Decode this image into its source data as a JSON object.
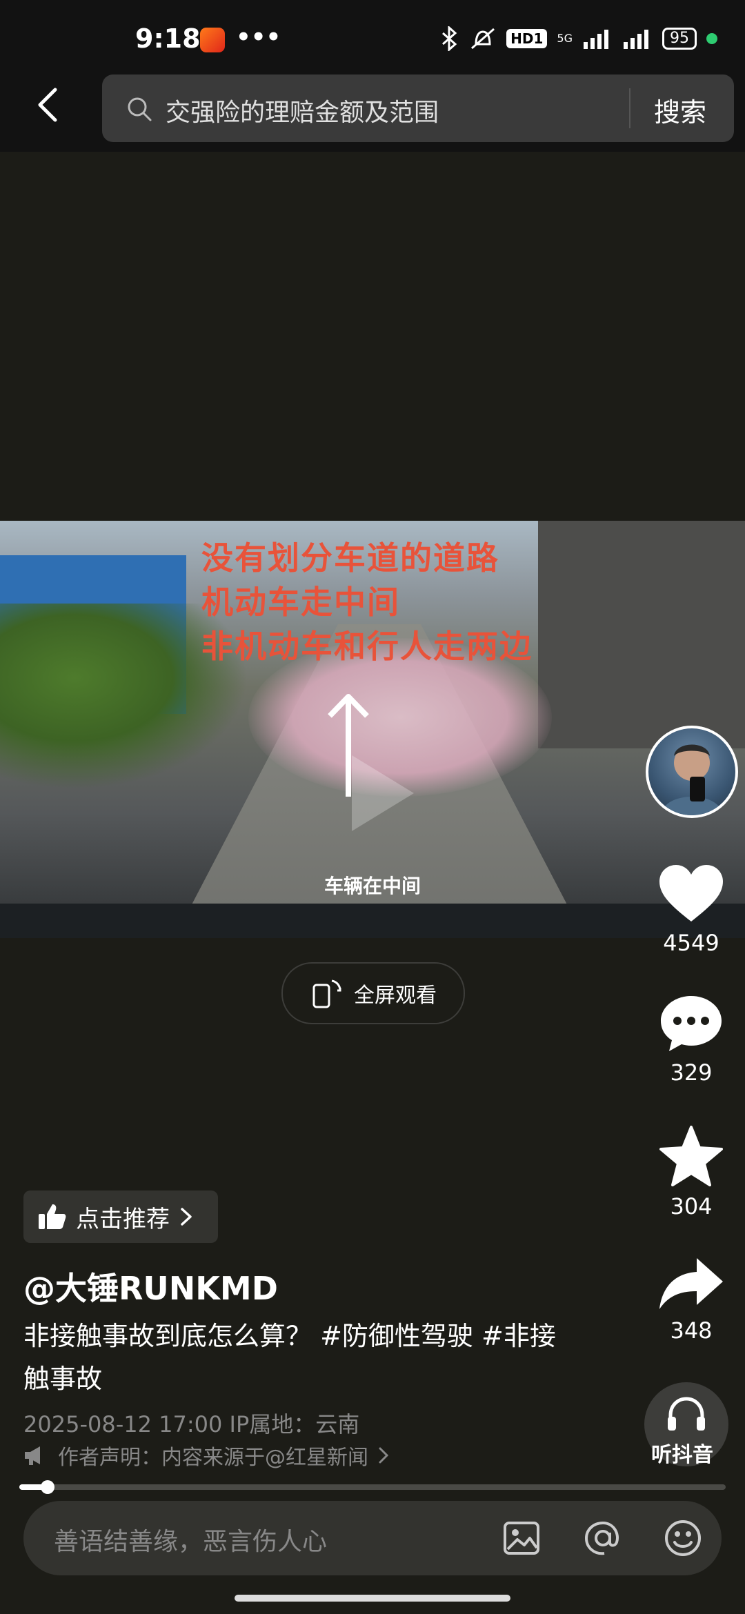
{
  "status_bar": {
    "time": "9:18",
    "dots": "•••",
    "hd": "HD1",
    "network": "5G",
    "battery": "95"
  },
  "search": {
    "query": "交强险的理赔金额及范围",
    "button_label": "搜索"
  },
  "video": {
    "overlay_lines": [
      "没有划分车道的道路",
      "机动车走中间",
      "非机动车和行人走两边"
    ],
    "caption": "车辆在中间",
    "overlay_color": "#e8533a"
  },
  "fullscreen": {
    "label": "全屏观看"
  },
  "actions": {
    "likes": "4549",
    "comments": "329",
    "favorites": "304",
    "shares": "348"
  },
  "recommend": {
    "label": "点击推荐"
  },
  "post": {
    "author": "@大锤RUNKMD",
    "description": "非接触事故到底怎么算？ #防御性驾驶 #非接触事故",
    "meta": "2025-08-12 17:00   IP属地：云南",
    "statement": "作者声明：内容来源于@红星新闻"
  },
  "listen": {
    "label": "听抖音"
  },
  "progress": {
    "fraction": 0.04
  },
  "comment": {
    "placeholder": "善语结善缘，恶言伤人心"
  }
}
